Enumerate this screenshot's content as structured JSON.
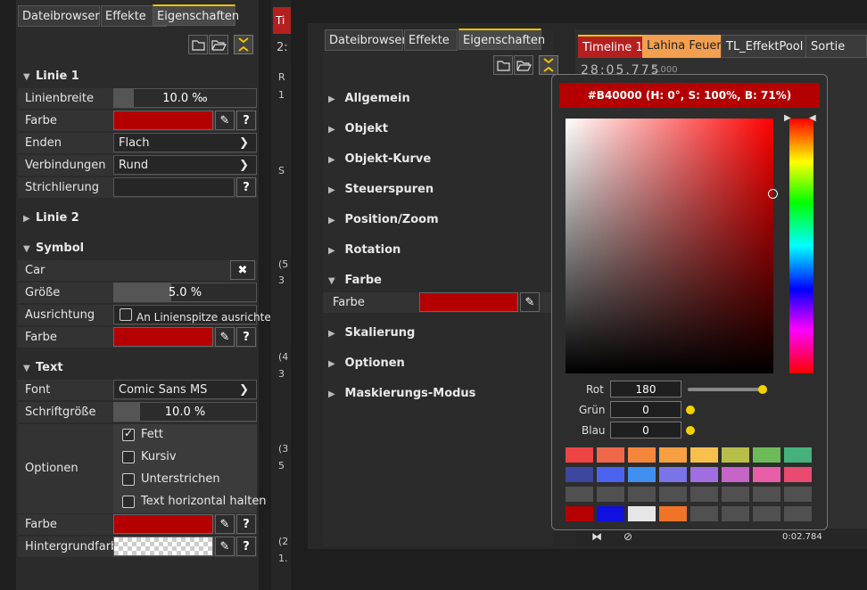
{
  "left_panel": {
    "tabs": [
      "Dateibrowser",
      "Effekte",
      "Eigenschaften"
    ],
    "linie1": {
      "title": "Linie 1",
      "rows": {
        "linienbreite": {
          "label": "Linienbreite",
          "value": "10.0 ‰",
          "fill": 0.14
        },
        "farbe": {
          "label": "Farbe"
        },
        "enden": {
          "label": "Enden",
          "value": "Flach"
        },
        "verbindungen": {
          "label": "Verbindungen",
          "value": "Rund"
        },
        "strichlierung": {
          "label": "Strichlierung"
        }
      }
    },
    "linie2": {
      "title": "Linie 2"
    },
    "symbol": {
      "title": "Symbol",
      "name": "Car",
      "groesse": {
        "label": "Größe",
        "value": "5.0 %",
        "fill": 0.4
      },
      "ausrichtung": {
        "label": "Ausrichtung",
        "checkbox": "An Linienspitze ausrichten"
      },
      "farbe": {
        "label": "Farbe"
      }
    },
    "text": {
      "title": "Text",
      "font": {
        "label": "Font",
        "value": "Comic Sans MS"
      },
      "schriftgroesse": {
        "label": "Schriftgröße",
        "value": "10.0 %",
        "fill": 0.18
      },
      "optionen": {
        "label": "Optionen",
        "fett": "Fett",
        "kursiv": "Kursiv",
        "unterstrichen": "Unterstrichen",
        "horizontal": "Text horizontal halten"
      },
      "farbe": {
        "label": "Farbe"
      },
      "hintergrund": {
        "label": "Hintergrundfarbe"
      }
    },
    "help": "?"
  },
  "mid_strip": {
    "tab": "Ti",
    "time": "2:",
    "items": [
      "R",
      "1",
      "S",
      "(5",
      "3",
      "(4",
      "3",
      "(3",
      "5",
      "(2",
      "1."
    ]
  },
  "right_panel": {
    "tabs": [
      "Dateibrowser",
      "Effekte",
      "Eigenschaften"
    ],
    "sections": [
      "Allgemein",
      "Objekt",
      "Objekt-Kurve",
      "Steuerspuren",
      "Position/Zoom",
      "Rotation",
      "Farbe",
      "Skalierung",
      "Optionen",
      "Maskierungs-Modus"
    ],
    "farbe_label": "Farbe"
  },
  "timeline": {
    "tabs": [
      "Timeline 1",
      "Lahina Feuer",
      "TL_EffektPool",
      "Sortie"
    ],
    "time": "28:05.775",
    "time_right": "5.000",
    "bottom_time": "0:02.784"
  },
  "picker": {
    "header": "#B40000 (H: 0°, S: 100%, B: 71%)",
    "rot": {
      "label": "Rot",
      "value": "180"
    },
    "gruen": {
      "label": "Grün",
      "value": "0"
    },
    "blau": {
      "label": "Blau",
      "value": "0"
    },
    "palette": [
      [
        "#ee4444",
        "#f0684a",
        "#f5873d",
        "#f6a042",
        "#f7c04c",
        "#b5bf4a",
        "#6cbb58",
        "#44b27a"
      ],
      [
        "#3c48a0",
        "#4a63f0",
        "#3f8ef0",
        "#7a74e8",
        "#a06ee0",
        "#c764c8",
        "#e85ea8",
        "#e84a70"
      ],
      [
        "#505050",
        "#505050",
        "#505050",
        "#505050",
        "#505050",
        "#505050",
        "#505050",
        "#505050"
      ],
      [
        "#b40000",
        "#1010e0",
        "#e6e6e6",
        "#f07428",
        "#505050",
        "#505050",
        "#505050",
        "#505050"
      ]
    ]
  },
  "colors": {
    "accent": "#f2c200",
    "selected": "#b40000"
  }
}
